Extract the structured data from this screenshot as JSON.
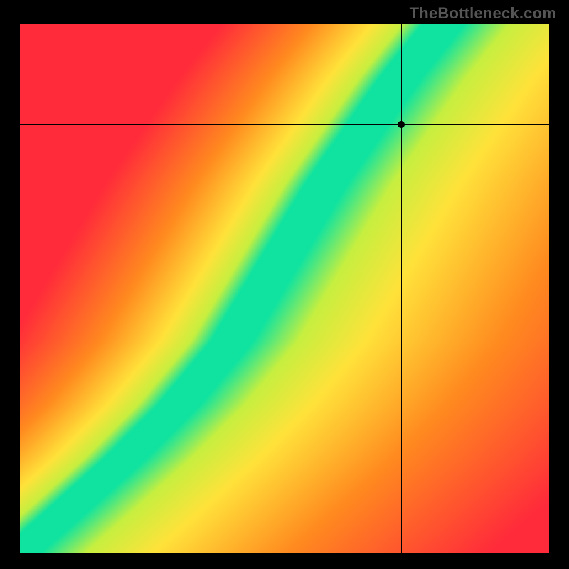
{
  "watermark": "TheBottleneck.com",
  "colors": {
    "red": "#ff2b3a",
    "orange": "#ff8a1f",
    "yellow": "#ffe23a",
    "yellowgreen": "#c7ef3f",
    "green": "#10e3a0",
    "background": "#000000",
    "crosshair": "#000000",
    "marker": "#000000"
  },
  "chart_data": {
    "type": "heatmap",
    "title": "",
    "xlabel": "",
    "ylabel": "",
    "xlim": [
      0,
      100
    ],
    "ylim": [
      0,
      100
    ],
    "crosshair": {
      "x": 72,
      "y": 81
    },
    "marker": {
      "x": 72,
      "y": 81
    },
    "optimal_curve": [
      {
        "x": 1,
        "y": 1
      },
      {
        "x": 10,
        "y": 9
      },
      {
        "x": 20,
        "y": 18
      },
      {
        "x": 30,
        "y": 28
      },
      {
        "x": 40,
        "y": 40
      },
      {
        "x": 46,
        "y": 50
      },
      {
        "x": 52,
        "y": 60
      },
      {
        "x": 58,
        "y": 70
      },
      {
        "x": 65,
        "y": 80
      },
      {
        "x": 72,
        "y": 90
      },
      {
        "x": 80,
        "y": 100
      }
    ],
    "band_half_width_percent": 4,
    "note": "Heatmap color encodes distance from the optimal curve: green on-curve, yellow near, orange/red far. Values estimated from pixel inspection."
  }
}
